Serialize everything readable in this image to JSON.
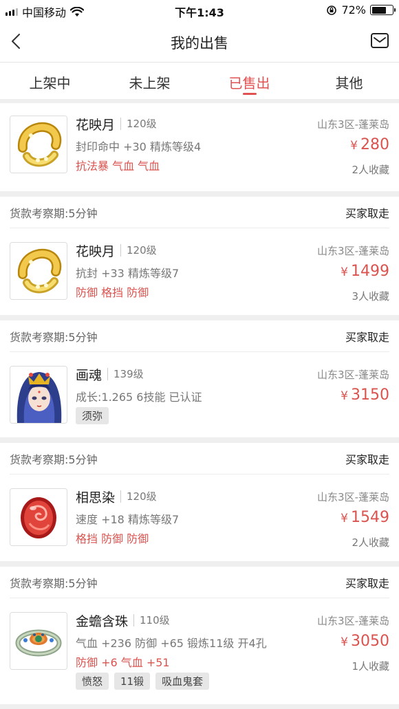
{
  "status_bar": {
    "carrier": "中国移动",
    "time": "下午1:43",
    "battery_pct": "72%",
    "battery_level": 0.72
  },
  "nav": {
    "title": "我的出售",
    "back_icon": "chevron-left-icon",
    "mail_icon": "mail-icon"
  },
  "tabs": [
    {
      "label": "上架中"
    },
    {
      "label": "未上架"
    },
    {
      "label": "已售出",
      "active": true
    },
    {
      "label": "其他"
    }
  ],
  "colors": {
    "accent": "#e05252",
    "price": "#d9534f"
  },
  "items": [
    {
      "period": "",
      "cancel": "",
      "name": "花映月",
      "level": "120级",
      "attrs": "封印命中 +30 精炼等级4",
      "extra": "抗法暴 气血 气血",
      "server": "山东3区-蓬莱岛",
      "currency": "¥",
      "price": "280",
      "favs": "2人收藏",
      "icon": "gold-bracelet-icon"
    },
    {
      "period": "货款考察期:5分钟",
      "cancel": "买家取走",
      "name": "花映月",
      "level": "120级",
      "attrs": "抗封 +33 精炼等级7",
      "extra": "防御 格挡 防御",
      "server": "山东3区-蓬莱岛",
      "currency": "¥",
      "price": "1499",
      "favs": "3人收藏",
      "icon": "gold-bracelet-icon"
    },
    {
      "period": "货款考察期:5分钟",
      "cancel": "买家取走",
      "name": "画魂",
      "level": "139级",
      "attrs": "成长:1.265 6技能 已认证",
      "tags": [
        "须弥"
      ],
      "server": "山东3区-蓬莱岛",
      "currency": "¥",
      "price": "3150",
      "favs": "",
      "icon": "character-portrait-icon"
    },
    {
      "period": "货款考察期:5分钟",
      "cancel": "买家取走",
      "name": "相思染",
      "level": "120级",
      "attrs": "速度 +18 精炼等级7",
      "extra": "格挡 防御 防御",
      "server": "山东3区-蓬莱岛",
      "currency": "¥",
      "price": "1549",
      "favs": "2人收藏",
      "icon": "red-gem-icon"
    },
    {
      "period": "货款考察期:5分钟",
      "cancel": "买家取走",
      "name": "金蟾含珠",
      "level": "110级",
      "attrs": "气血 +236 防御 +65 锻炼11级 开4孔",
      "extra": "防御 +6 气血 +51",
      "tags": [
        "愤怒",
        "11锻",
        "吸血鬼套"
      ],
      "server": "山东3区-蓬莱岛",
      "currency": "¥",
      "price": "3050",
      "favs": "1人收藏",
      "icon": "jade-ring-icon"
    }
  ]
}
